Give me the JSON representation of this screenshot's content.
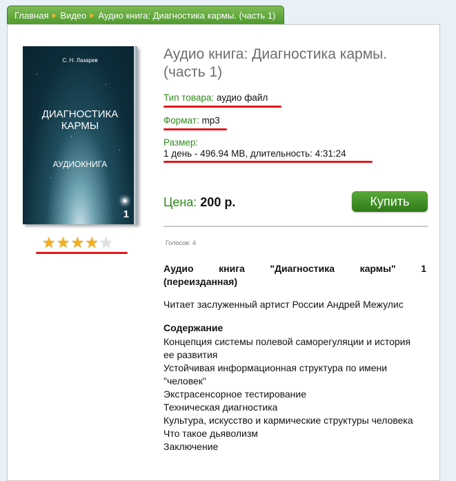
{
  "breadcrumb": {
    "items": [
      "Главная",
      "Видео",
      "Аудио книга: Диагностика кармы. (часть 1)"
    ]
  },
  "product": {
    "title_line1": "Аудио книга: Диагностика кармы.",
    "title_line2": "(часть 1)",
    "type_label": "Тип товара:",
    "type_value": "аудио файл",
    "format_label": "Формат:",
    "format_value": "mp3",
    "size_label": "Размер:",
    "size_value": "1 день - 496.94 MB, длительность: 4:31:24",
    "price_label": "Цена:",
    "price_value": "200 р.",
    "buy_label": "Купить",
    "votes": "Голосов: 4",
    "rating": 4,
    "rating_max": 5
  },
  "cover": {
    "author": "С. Н. Лазарев",
    "title_line1": "ДИАГНОСТИКА",
    "title_line2": "КАРМЫ",
    "subtitle": "АУДИОКНИГА",
    "number": "1"
  },
  "description": {
    "heading": "Аудио книга \"Диагностика кармы\" 1 (переизданная)",
    "reader": "Читает заслуженный артист России Андрей Межулис",
    "contents_heading": "Содержание",
    "contents": [
      "Концепция системы полевой саморегуляции и история ее развития",
      "Устойчивая информационная структура по имени \"человек\"",
      "Экстрасенсорное тестирование",
      "Техническая диагностика",
      "Культура, искусство и кармические структуры человека",
      "Что такое дьяволизм",
      "Заключение"
    ]
  },
  "colors": {
    "accent_green": "#2f8a1c",
    "breadcrumb_green": "#5aa83a",
    "highlight_red": "#e3171b",
    "star_gold": "#f2b01e"
  }
}
